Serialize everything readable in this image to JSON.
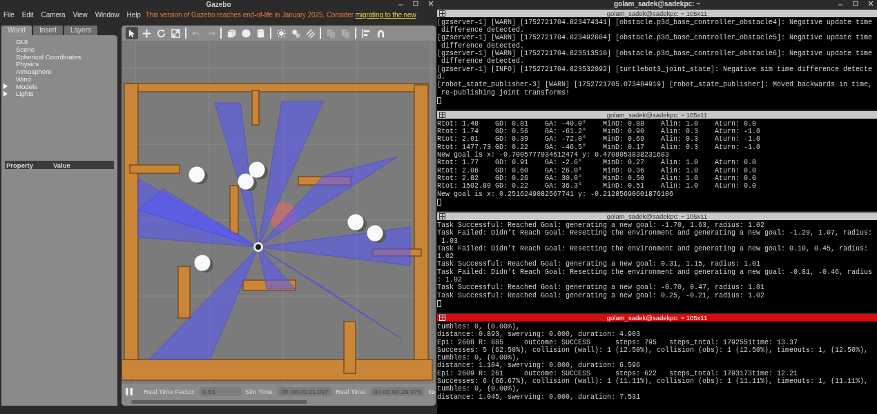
{
  "gazebo": {
    "title": "Gazebo",
    "menu": [
      "File",
      "Edit",
      "Camera",
      "View",
      "Window",
      "Help"
    ],
    "notice": {
      "text": "This version of Gazebo reaches end-of-life in January 2025. Consider ",
      "link": "migrating to the new"
    },
    "toolbar": {
      "transform_tools": [
        {
          "selected": true
        },
        {
          "selected": false
        },
        {
          "selected": false
        },
        {
          "selected": false
        }
      ],
      "history": [
        {
          "disabled": true
        },
        {
          "disabled": true
        }
      ],
      "clipboard": [
        {
          "disabled": true
        },
        {
          "disabled": true
        }
      ]
    },
    "tabs": [
      {
        "label": "World",
        "selected": true
      },
      {
        "label": "Insert",
        "selected": false
      },
      {
        "label": "Layers",
        "selected": false
      }
    ],
    "tree": [
      {
        "label": "GUI",
        "kind": "leaf"
      },
      {
        "label": "Scene",
        "kind": "leaf"
      },
      {
        "label": "Spherical Coordinates",
        "kind": "leaf"
      },
      {
        "label": "Physics",
        "kind": "leaf"
      },
      {
        "label": "Atmosphere",
        "kind": "leaf"
      },
      {
        "label": "Wind",
        "kind": "leaf"
      },
      {
        "label": "Models",
        "kind": "group",
        "expanded": false
      },
      {
        "label": "Lights",
        "kind": "group",
        "expanded": false
      }
    ],
    "property_table": {
      "columns": [
        "Property",
        "Value"
      ]
    },
    "status": {
      "paused": false,
      "real_time_factor_label": "Real Time Factor:",
      "real_time_factor": "0.63",
      "sim_time_label": "Sim Time:",
      "sim_time": "00 00:00:21.097",
      "real_time_label": "Real Time:",
      "real_time": "00 00:00:29.975",
      "iterations_label": "Ite"
    }
  },
  "terminal": {
    "title": "golam_sadek@sadekpc: ~",
    "panes": [
      {
        "title": "golam_sadek@sadekpc: ~ 105x11",
        "active": false,
        "cursor": true,
        "lines": [
          "[gzserver-1] [WARN] [1752721704.823474341] [obstacle.p3d_base_controller_obstacle4]: Negative update time",
          " difference detected.",
          "[gzserver-1] [WARN] [1752721704.823492604] [obstacle.p3d_base_controller_obstacle5]: Negative update time",
          " difference detected.",
          "[gzserver-1] [WARN] [1752721704.823513510] [obstacle.p3d_base_controller_obstacle6]: Negative update time",
          " difference detected.",
          "[gzserver-1] [INFO] [1752721704.823532092] [turtlebot3_joint_state]: Negative sim time difference detecte",
          "d.",
          "[robot_state_publisher-3] [WARN] [1752721705.073484919] [robot_state_publisher]: Moved backwards in time,",
          " re-publishing joint transforms!"
        ]
      },
      {
        "title": "golam_sadek@sadekpc: ~ 105x11",
        "active": false,
        "cursor": true,
        "lines": [
          "Rtot: 1.48    GD: 0.81    GA: -40.0°    MinD: 0.88    Alin: 1.0    Aturn: 0.0",
          "Rtot: 1.74    GD: 0.56    GA: -61.2°    MinD: 0.90    Alin: 0.3    Aturn: -1.0",
          "Rtot: 2.01    GD: 0.39    GA: -72.0°    MinD: 0.69    Alin: 0.3    Aturn: -1.0",
          "Rtot: 1477.73 GD: 0.22    GA: -46.5°    MinD: 0.17    Alin: 0.3    Aturn: -1.0",
          "New goal is x: -0.7005777934612474 y: 0.4708053838231683",
          "Rtot: 1.77    GD: 0.91    GA: -2.6°     MinD: 0.27    Alin: 1.0    Aturn: 0.0",
          "Rtot: 2.06    GD: 0.60    GA: 26.0°     MinD: 0.36    Alin: 1.0    Aturn: 0.0",
          "Rtot: 2.82    GD: 0.26    GA: 30.0°     MinD: 0.50    Alin: 1.0    Aturn: 0.0",
          "Rtot: 1502.89 GD: 0.22    GA: 36.3°     MinD: 0.51    Alin: 1.0    Aturn: 0.0",
          "New goal is x: 0.2516249082567741 y: -0.21285690601876106"
        ]
      },
      {
        "title": "golam_sadek@sadekpc: ~ 105x11",
        "active": false,
        "cursor": true,
        "lines": [
          "Task Successful: Reached Goal: generating a new goal: -1.70, 1.63, radius: 1.02",
          "Task Failed: Didn't Reach Goal: Resetting the environment and generating a new goal: -1.29, 1.07, radius:",
          " 1.03",
          "Task Failed: Didn't Reach Goal: Resetting the environment and generating a new goal: 0.10, 0.45, radius:",
          "1.02",
          "Task Successful: Reached Goal: generating a new goal: 0.31, 1.15, radius: 1.01",
          "Task Failed: Didn't Reach Goal: Resetting the environment and generating a new goal: -0.81, -0.46, radius",
          ": 1.02",
          "Task Successful: Reached Goal: generating a new goal: -0.70, 0.47, radius: 1.01",
          "Task Successful: Reached Goal: generating a new goal: 0.25, -0.21, radius: 1.02"
        ]
      },
      {
        "title": "golam_sadek@sadekpc: ~ 105x11",
        "active": true,
        "cursor": false,
        "lines": [
          "tumbles: 0, (0.00%),",
          "distance: 0.893, swerving: 0.000, duration: 4.903",
          "Epi: 2608 R: 885     outcome: SUCCESS      steps: 795   steps_total: 1792551time: 13.37",
          "Successes: 5 (62.50%), collision (wall): 1 (12.50%), collision (obs): 1 (12.50%), timeouts: 1, (12.50%),",
          "tumbles: 0, (0.00%),",
          "distance: 1.104, swerving: 0.000, duration: 6.596",
          "Epi: 2609 R: 261     outcome: SUCCESS      steps: 622   steps_total: 1793173time: 12.21",
          "Successes: 6 (66.67%), collision (wall): 1 (11.11%), collision (obs): 1 (11.11%), timeouts: 1, (11.11%),",
          "tumbles: 0, (0.00%),",
          "distance: 1.045, swerving: 0.000, duration: 7.531"
        ]
      }
    ]
  }
}
